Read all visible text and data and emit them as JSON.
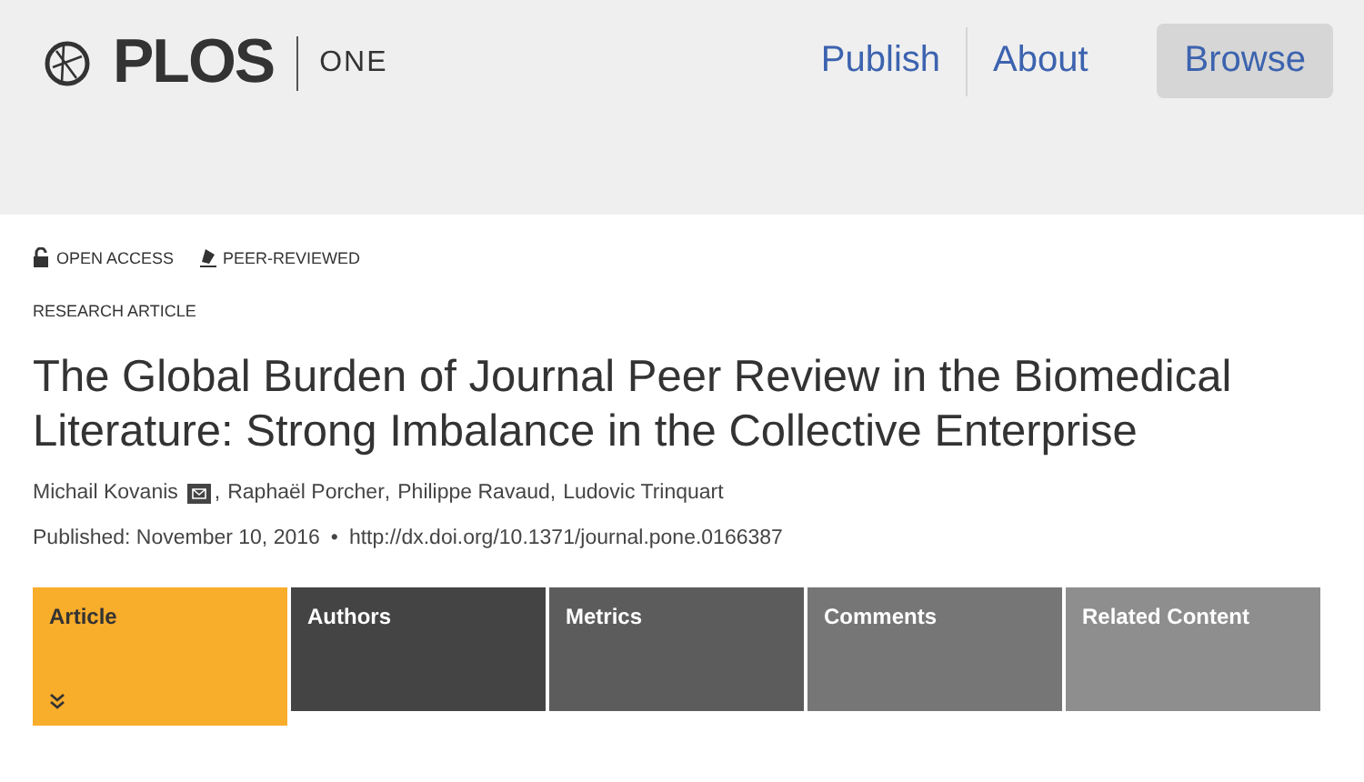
{
  "header": {
    "logo": {
      "brand": "PLOS",
      "journal": "ONE"
    },
    "nav": [
      {
        "label": "Publish",
        "selected": false
      },
      {
        "label": "About",
        "selected": false
      },
      {
        "label": "Browse",
        "selected": true
      }
    ]
  },
  "badges": [
    "OPEN ACCESS",
    "PEER-REVIEWED"
  ],
  "article_type": "RESEARCH ARTICLE",
  "title": "The Global Burden of Journal Peer Review in the Biomedical Literature: Strong Imbalance in the Collective Enterprise",
  "authors": [
    "Michail Kovanis",
    "Raphaël Porcher",
    "Philippe Ravaud",
    "Ludovic Trinquart"
  ],
  "author_separator": ",",
  "meta_separator": "•",
  "published": "Published: November 10, 2016",
  "doi": "http://dx.doi.org/10.1371/journal.pone.0166387",
  "tabs": [
    {
      "label": "Article",
      "selected": true,
      "color": "#f8ad2b"
    },
    {
      "label": "Authors",
      "selected": false,
      "color": "#444444"
    },
    {
      "label": "Metrics",
      "selected": false,
      "color": "#5c5c5c"
    },
    {
      "label": "Comments",
      "selected": false,
      "color": "#767676"
    },
    {
      "label": "Related Content",
      "selected": false,
      "color": "#8e8e8e"
    }
  ]
}
